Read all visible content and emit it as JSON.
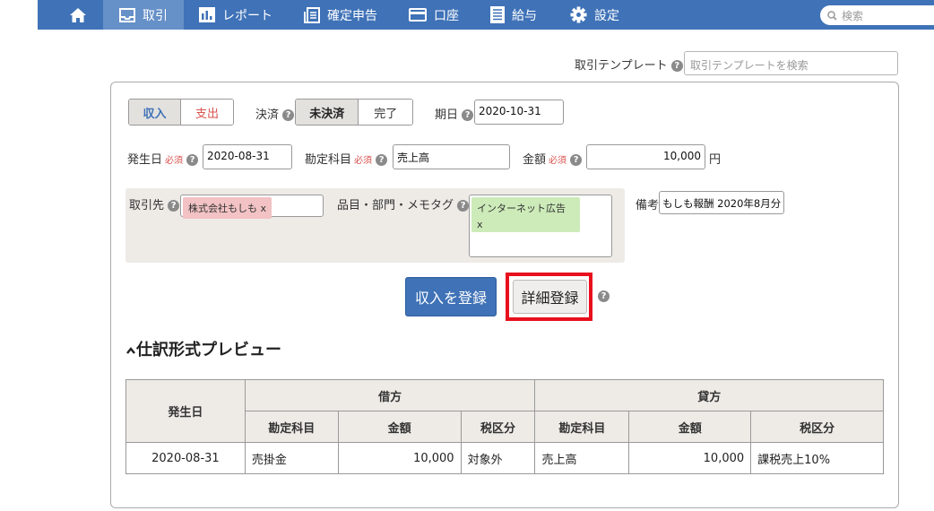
{
  "nav": {
    "items": [
      {
        "label": "",
        "icon": "home-icon"
      },
      {
        "label": "取引",
        "icon": "inbox-icon"
      },
      {
        "label": "レポート",
        "icon": "bar-chart-icon"
      },
      {
        "label": "確定申告",
        "icon": "document-icon"
      },
      {
        "label": "口座",
        "icon": "credit-card-icon"
      },
      {
        "label": "給与",
        "icon": "list-icon"
      },
      {
        "label": "設定",
        "icon": "gear-icon"
      }
    ],
    "search_placeholder": "検索",
    "bg_color": "#3f72b7",
    "active_color": "#6690c8"
  },
  "template": {
    "label": "取引テンプレート",
    "placeholder": "取引テンプレートを検索"
  },
  "form": {
    "type_income": "収入",
    "type_expense": "支出",
    "settlement_label": "決済",
    "unsettled": "未決済",
    "settled": "完了",
    "due_label": "期日",
    "due_value": "2020-10-31",
    "issue_label": "発生日",
    "required": "必須",
    "issue_value": "2020-08-31",
    "account_label": "勘定科目",
    "account_value": "売上高",
    "amount_label": "金額",
    "amount_value": "10,000",
    "yen": "円",
    "partner_label": "取引先",
    "partner_tag": "株式会社もしも x",
    "items_label": "品目・部門・メモタグ",
    "memo_tag_line1": "インターネット広告",
    "memo_tag_line2": "x",
    "remarks_label": "備考",
    "remarks_value": "もしも報酬 2020年8月分"
  },
  "buttons": {
    "register": "収入を登録",
    "detail": "詳細登録"
  },
  "preview": {
    "title": "仕訳形式プレビュー",
    "headers": {
      "date": "発生日",
      "debit": "借方",
      "credit": "貸方",
      "account": "勘定科目",
      "amount": "金額",
      "tax": "税区分"
    },
    "row": {
      "date": "2020-08-31",
      "debit_account": "売掛金",
      "debit_amount": "10,000",
      "debit_tax": "対象外",
      "credit_account": "売上高",
      "credit_amount": "10,000",
      "credit_tax": "課税売上10%"
    }
  },
  "colors": {
    "income_text": "#3f72b7",
    "expense_text": "#d9534f",
    "partner_tag_bg": "#f2c2c4",
    "memo_tag_bg": "#cdebb9",
    "highlight": "#e8101d"
  }
}
